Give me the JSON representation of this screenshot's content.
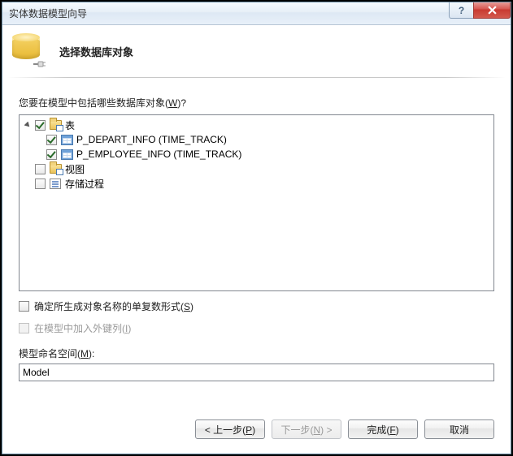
{
  "window": {
    "title": "实体数据模型向导"
  },
  "header": {
    "heading": "选择数据库对象"
  },
  "prompt": {
    "text_prefix": "您要在模型中包括哪些数据库对象",
    "accel": "W",
    "text_suffix": "?"
  },
  "tree": {
    "tables": {
      "label": "表",
      "checked": true,
      "expanded": true,
      "items": [
        {
          "label": "P_DEPART_INFO (TIME_TRACK)",
          "checked": true
        },
        {
          "label": "P_EMPLOYEE_INFO (TIME_TRACK)",
          "checked": true
        }
      ]
    },
    "views": {
      "label": "视图",
      "checked": false
    },
    "sprocs": {
      "label": "存储过程",
      "checked": false
    }
  },
  "options": {
    "pluralize": {
      "text_prefix": "确定所生成对象名称的单复数形式(",
      "accel": "S",
      "text_suffix": ")",
      "checked": false,
      "enabled": true
    },
    "include_fk": {
      "text_prefix": "在模型中加入外键列(",
      "accel": "I",
      "text_suffix": ")",
      "checked": false,
      "enabled": false
    }
  },
  "namespace": {
    "label_prefix": "模型命名空间(",
    "accel": "M",
    "label_suffix": "):",
    "value": "Model"
  },
  "buttons": {
    "prev": {
      "prefix": "< 上一步(",
      "accel": "P",
      "suffix": ")",
      "enabled": true
    },
    "next": {
      "prefix": "下一步(",
      "accel": "N",
      "suffix": ") >",
      "enabled": false
    },
    "finish": {
      "prefix": "完成(",
      "accel": "F",
      "suffix": ")",
      "enabled": true
    },
    "cancel": {
      "label": "取消",
      "enabled": true
    }
  }
}
